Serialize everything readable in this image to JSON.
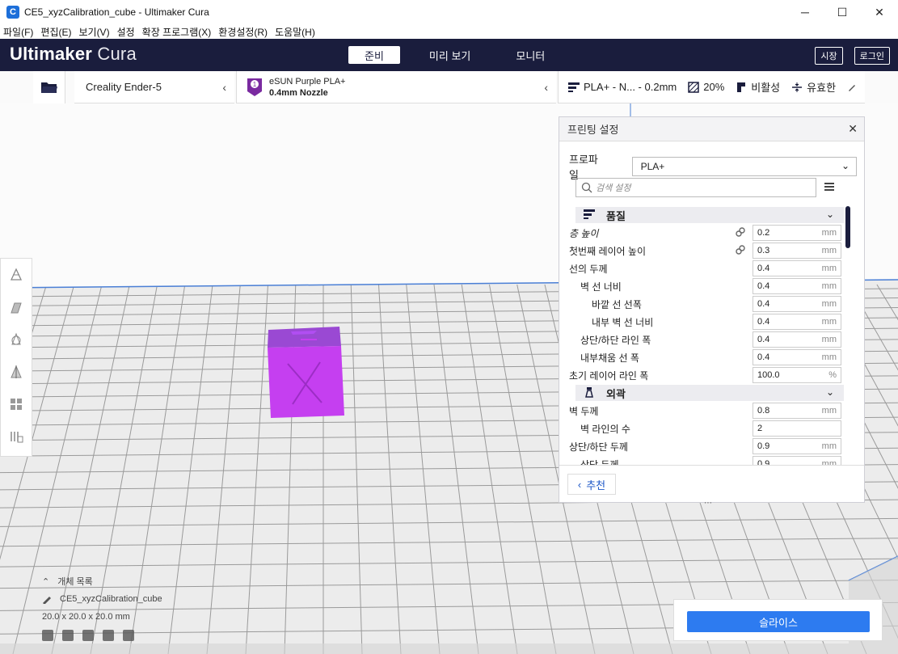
{
  "window": {
    "title": "CE5_xyzCalibration_cube - Ultimaker Cura",
    "app_icon": "C",
    "controls": [
      "─",
      "☐",
      "✕"
    ]
  },
  "menu": [
    "파일(F)",
    "편집(E)",
    "보기(V)",
    "설정",
    "확장 프로그램(X)",
    "환경설정(R)",
    "도움말(H)"
  ],
  "header": {
    "logo_primary": "Ultimaker",
    "logo_secondary": "Cura",
    "tabs": [
      "준비",
      "미리 보기",
      "모니터"
    ],
    "active_tab": "준비",
    "marketplace": "시장",
    "login": "로그인"
  },
  "toolbar": {
    "printer": "Creality Ender-5",
    "material_name": "eSUN Purple PLA+",
    "nozzle": "0.4mm Nozzle",
    "material_badge": "1",
    "profile_summary": "PLA+ - N... - 0.2mm",
    "infill": "20%",
    "support": "비활성",
    "adhesion": "유효한"
  },
  "panel": {
    "title": "프린팅 설정",
    "profile_label": "프로파일",
    "profile_value": "PLA+",
    "search_placeholder": "검색 설정",
    "categories": [
      {
        "name": "품질",
        "rows": [
          {
            "label": "층 높이",
            "value": "0.2",
            "unit": "mm",
            "indent": 0,
            "link": true,
            "italic": true
          },
          {
            "label": "첫번째 레이어 높이",
            "value": "0.3",
            "unit": "mm",
            "indent": 0,
            "link": true
          },
          {
            "label": "선의 두께",
            "value": "0.4",
            "unit": "mm",
            "indent": 0
          },
          {
            "label": "벽 선 너비",
            "value": "0.4",
            "unit": "mm",
            "indent": 1
          },
          {
            "label": "바깥 선 선폭",
            "value": "0.4",
            "unit": "mm",
            "indent": 2
          },
          {
            "label": "내부 벽 선 너비",
            "value": "0.4",
            "unit": "mm",
            "indent": 2
          },
          {
            "label": "상단/하단 라인 폭",
            "value": "0.4",
            "unit": "mm",
            "indent": 1
          },
          {
            "label": "내부채움 선 폭",
            "value": "0.4",
            "unit": "mm",
            "indent": 1
          },
          {
            "label": "초기 레이어 라인 폭",
            "value": "100.0",
            "unit": "%",
            "indent": 0
          }
        ]
      },
      {
        "name": "외곽",
        "rows": [
          {
            "label": "벽 두께",
            "value": "0.8",
            "unit": "mm",
            "indent": 0
          },
          {
            "label": "벽 라인의 수",
            "value": "2",
            "unit": "",
            "indent": 1
          },
          {
            "label": "상단/하단 두께",
            "value": "0.9",
            "unit": "mm",
            "indent": 0
          },
          {
            "label": "상단 두께",
            "value": "0.9",
            "unit": "mm",
            "indent": 1
          }
        ]
      }
    ],
    "recommended": "추천"
  },
  "object_list": {
    "header": "개체 목록",
    "object_name": "CE5_xyzCalibration_cube",
    "dimensions": "20.0 x 20.0 x 20.0 mm"
  },
  "slice": {
    "button": "슬라이스"
  },
  "colors": {
    "header_bg": "#1a1d3d",
    "accent_blue": "#2d7bf0",
    "model_purple": "#c53ff0",
    "build_plate": "#ececec"
  }
}
